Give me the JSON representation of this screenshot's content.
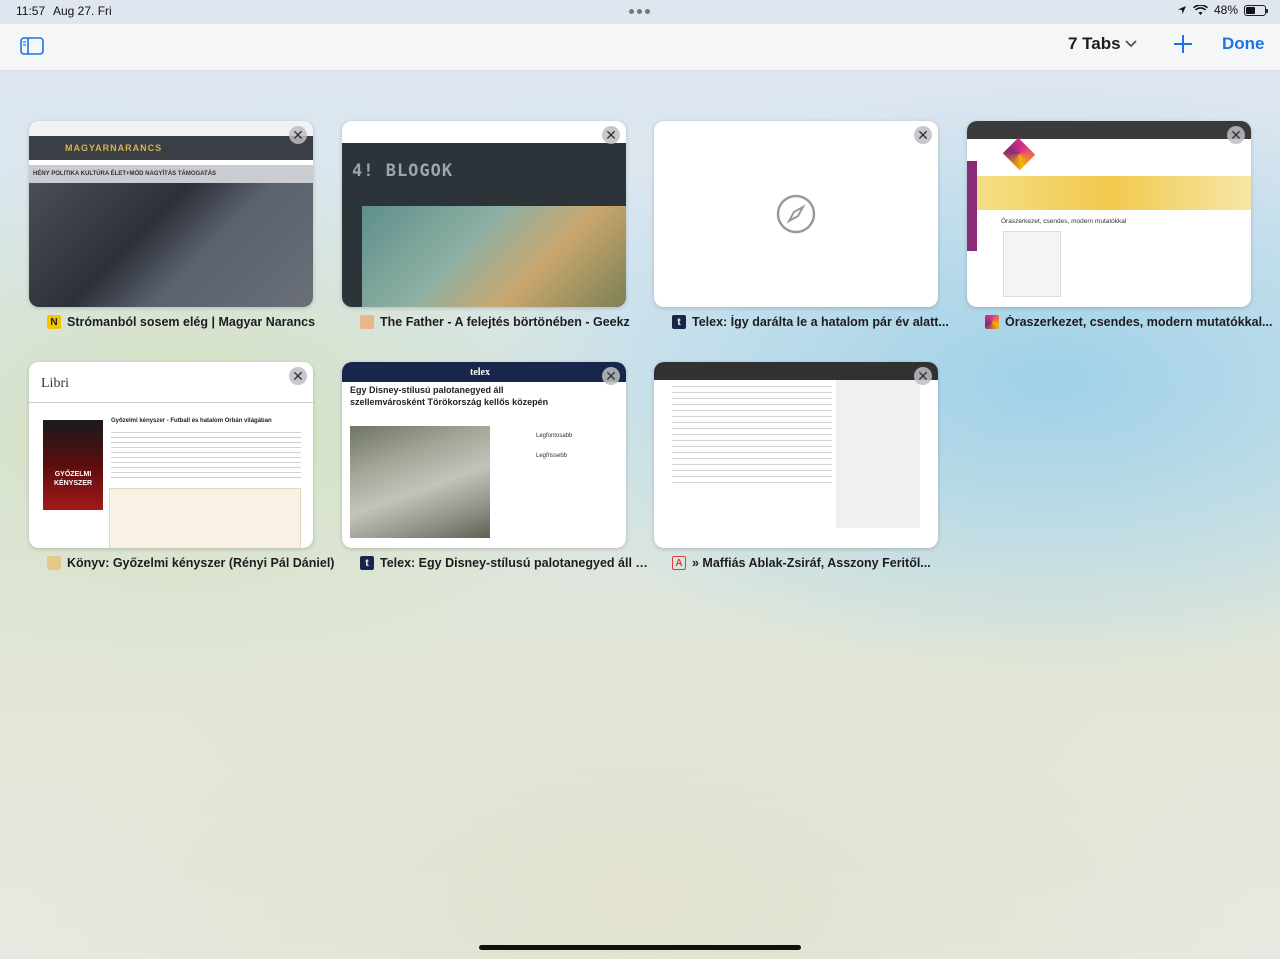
{
  "status_bar": {
    "time": "11:57",
    "date": "Aug 27. Fri",
    "battery": "48%",
    "battery_level": 0.48
  },
  "toolbar": {
    "tabs_label": "7 Tabs",
    "done_label": "Done"
  },
  "tabs": [
    {
      "title": "Strómanból sosem elég | Magyar Narancs",
      "favicon": "N",
      "favicon_color": "#f3c500"
    },
    {
      "title": "The Father - A felejtés börtönében - Geekz",
      "favicon": "",
      "favicon_color": "#e7b68a"
    },
    {
      "title": "Telex: Így darálta le a hatalom pár év alatt...",
      "favicon": "t",
      "favicon_color": "#17264a"
    },
    {
      "title": "Óraszerkezet, csendes, modern mutatókkal...",
      "favicon": "",
      "favicon_color": "#e3338a"
    },
    {
      "title": "Könyv: Győzelmi kényszer (Rényi Pál Dániel)",
      "favicon": "",
      "favicon_color": "#e4c98a"
    },
    {
      "title": "Telex: Egy Disney-stílusú palotanegyed áll s...",
      "favicon": "t",
      "favicon_color": "#17264a"
    },
    {
      "title": "» Maffiás Ablak-Zsiráf, Asszony Feritől...",
      "favicon": "A",
      "favicon_color": "#e23b3b"
    }
  ],
  "thumbnails": {
    "magyar_narancs": {
      "logo": "MAGYARNARANCS",
      "nav": "HÉNY  POLITIKA  KULTÚRA  ÉLET+MÓD  NAGYÍTÁS  TÁMOGATÁS"
    },
    "geekz": {
      "logo": "4! BLOGOK"
    },
    "kreativ": {
      "heading": "Óraszerkezet, csendes, modern mutatókkal"
    },
    "libri": {
      "logo": "Libri",
      "title": "Győzelmi kényszer - Futball és hatalom Orbán világában",
      "cover": "GYŐZELMI KÉNYSZER"
    },
    "telex": {
      "logo": "telex",
      "headline": "Egy Disney-stílusú palotanegyed áll szellemvárosként Törökország kellős közepén",
      "side1": "Legfontosabb",
      "side2": "Legfrissebb"
    }
  }
}
